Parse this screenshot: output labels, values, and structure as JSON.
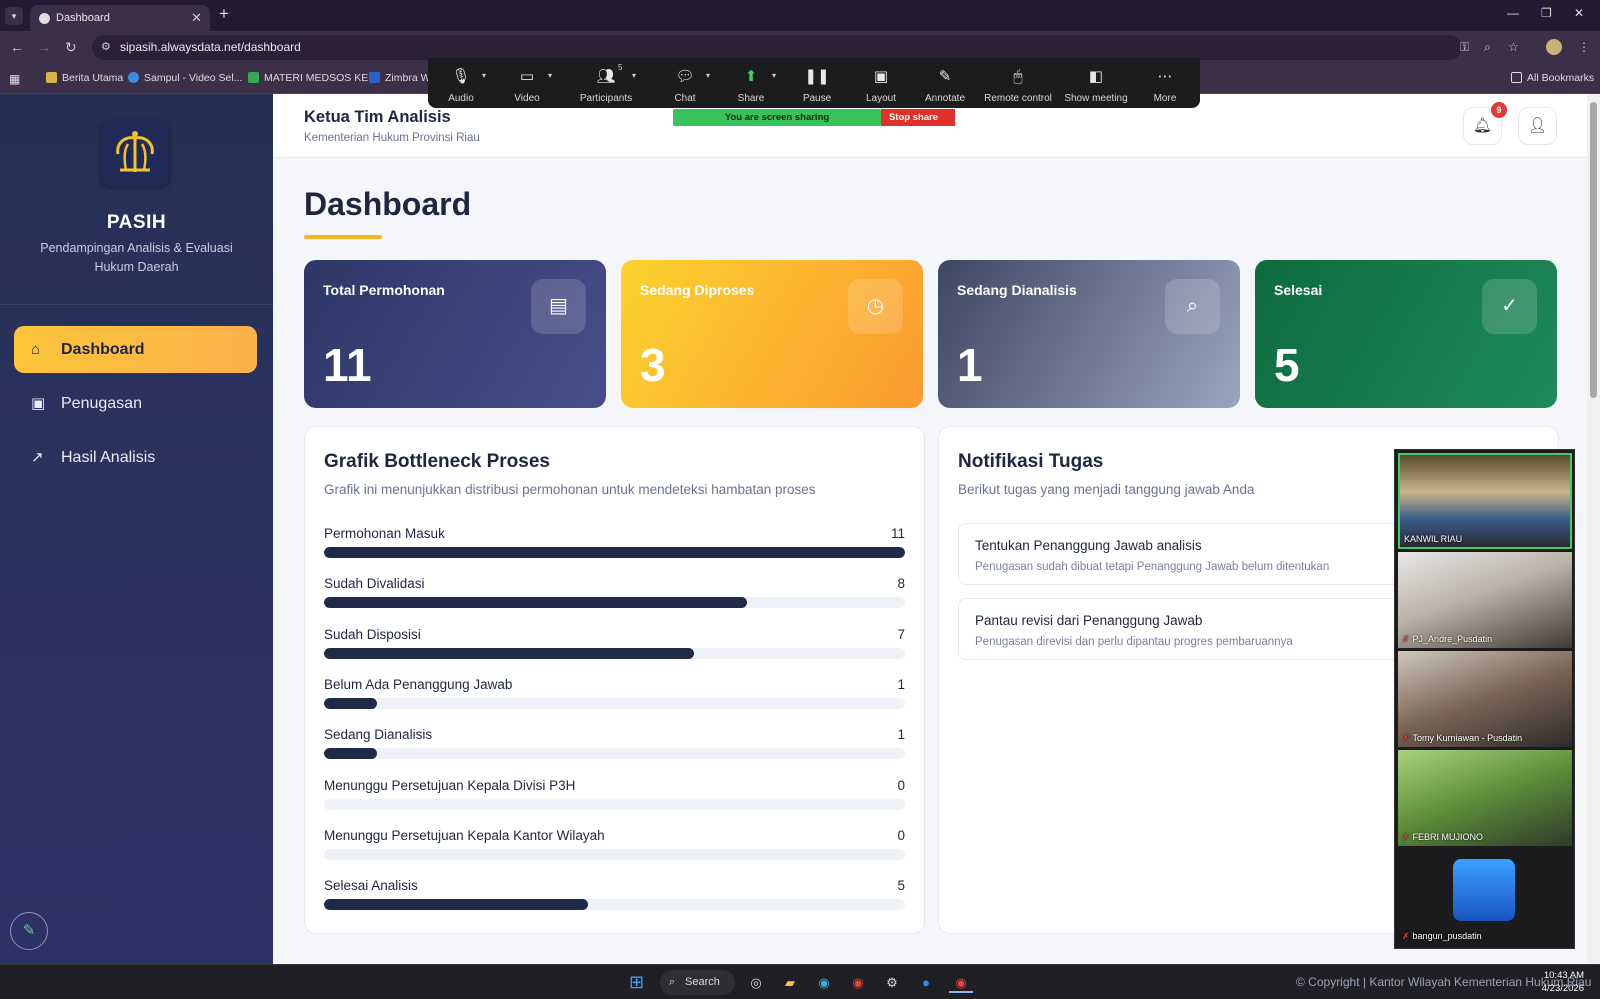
{
  "browser": {
    "tab_title": "Dashboard",
    "url": "sipasih.alwaysdata.net/dashboard",
    "bookmarks": [
      "Berita Utama",
      "Sampul - Video Sel...",
      "MATERI MEDSOS KE...",
      "Zimbra W"
    ],
    "all_bookmarks": "All Bookmarks"
  },
  "zoom": {
    "toolbar": [
      "Audio",
      "Video",
      "Participants",
      "Chat",
      "Share",
      "Pause",
      "Layout",
      "Annotate",
      "Remote control",
      "Show meeting",
      "More"
    ],
    "participants_count": "5",
    "sharing_text": "You are screen sharing",
    "stop_share": "Stop share"
  },
  "sidebar": {
    "app_name": "PASIH",
    "tagline": "Pendampingan Analisis & Evaluasi Hukum Daerah",
    "items": [
      {
        "label": "Dashboard",
        "active": true,
        "icon": "home-icon"
      },
      {
        "label": "Penugasan",
        "active": false,
        "icon": "clipboard-icon"
      },
      {
        "label": "Hasil Analisis",
        "active": false,
        "icon": "chart-line-icon"
      }
    ]
  },
  "header": {
    "title": "Ketua Tim Analisis",
    "subtitle": "Kementerian Hukum Provinsi Riau",
    "notification_count": "9"
  },
  "page": {
    "title": "Dashboard"
  },
  "stats": [
    {
      "label": "Total Permohonan",
      "value": "11",
      "icon": "document-icon"
    },
    {
      "label": "Sedang Diproses",
      "value": "3",
      "icon": "clock-icon"
    },
    {
      "label": "Sedang Dianalisis",
      "value": "1",
      "icon": "search-icon"
    },
    {
      "label": "Selesai",
      "value": "5",
      "icon": "check-circle-icon"
    }
  ],
  "bottleneck": {
    "title": "Grafik Bottleneck Proses",
    "description": "Grafik ini menunjukkan distribusi permohonan untuk mendeteksi hambatan proses",
    "max": 11,
    "rows": [
      {
        "label": "Permohonan Masuk",
        "value": 11
      },
      {
        "label": "Sudah Divalidasi",
        "value": 8
      },
      {
        "label": "Sudah Disposisi",
        "value": 7
      },
      {
        "label": "Belum Ada Penanggung Jawab",
        "value": 1
      },
      {
        "label": "Sedang Dianalisis",
        "value": 1
      },
      {
        "label": "Menunggu Persetujuan Kepala Divisi P3H",
        "value": 0
      },
      {
        "label": "Menunggu Persetujuan Kepala Kantor Wilayah",
        "value": 0
      },
      {
        "label": "Selesai Analisis",
        "value": 5
      }
    ]
  },
  "notifications": {
    "title": "Notifikasi Tugas",
    "description": "Berikut tugas yang menjadi tanggung jawab Anda",
    "items": [
      {
        "title": "Tentukan Penanggung Jawab analisis",
        "desc": "Penugasan sudah dibuat tetapi Penanggung Jawab belum ditentukan"
      },
      {
        "title": "Pantau revisi dari Penanggung Jawab",
        "desc": "Penugasan direvisi dan perlu dipantau progres pembaruannya"
      }
    ]
  },
  "video": {
    "participants": [
      "KANWIL RIAU",
      "PJ_Andre_Pusdatin",
      "Tomy Kurniawan - Pusdatin",
      "FEBRI MUJIONO",
      "bangun_pusdatin"
    ]
  },
  "footer": {
    "copyright": "© Copyright | Kantor Wilayah Kementerian Hukum Riau"
  },
  "taskbar": {
    "search": "Search",
    "time": "10:43 AM",
    "date": "4/23/2026"
  }
}
